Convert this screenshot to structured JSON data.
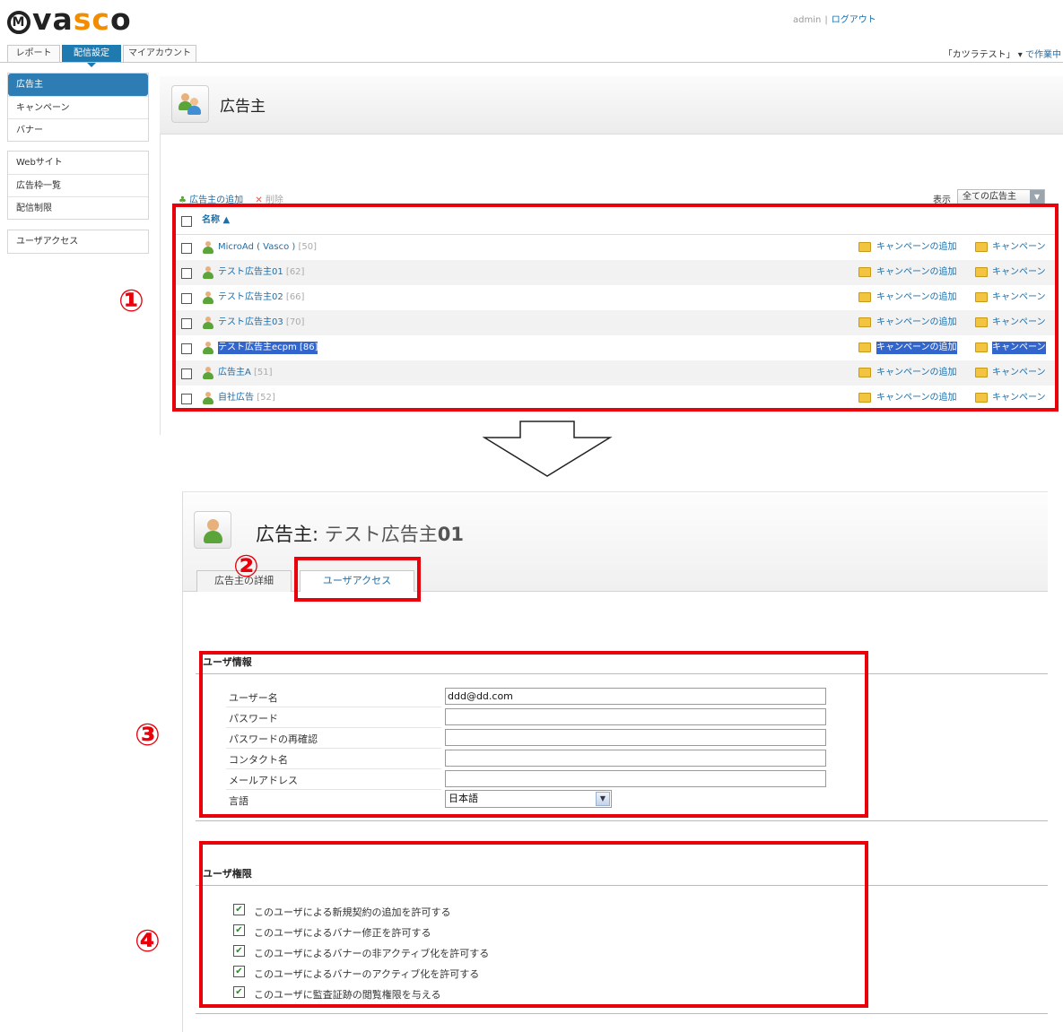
{
  "header": {
    "logo": "vasco",
    "user": "admin",
    "logout": "ログアウト",
    "workspace": "「カツラテスト」",
    "workspace_link": "で作業中"
  },
  "tabs": [
    "レポート",
    "配信設定",
    "マイアカウント"
  ],
  "sidebar": {
    "group1": [
      "広告主",
      "キャンペーン",
      "バナー"
    ],
    "group2": [
      "Webサイト",
      "広告枠一覧",
      "配信制限"
    ],
    "group3": [
      "ユーザアクセス"
    ]
  },
  "top_panel": {
    "title": "広告主",
    "add_label": "広告主の追加",
    "delete_label": "削除",
    "show_label": "表示",
    "show_value": "全ての広告主",
    "name_header": "名称",
    "rows": [
      {
        "name": "MicroAd ( Vasco )",
        "id": "[50]"
      },
      {
        "name": "テスト広告主01",
        "id": "[62]"
      },
      {
        "name": "テスト広告主02",
        "id": "[66]"
      },
      {
        "name": "テスト広告主03",
        "id": "[70]"
      },
      {
        "name": "テスト広告主ecpm",
        "id": "[86]"
      },
      {
        "name": "広告主A",
        "id": "[51]"
      },
      {
        "name": "自社広告",
        "id": "[52]"
      }
    ],
    "col_add_campaign": "キャンペーンの追加",
    "col_campaign": "キャンペーン"
  },
  "annotations": [
    "①",
    "②",
    "③",
    "④"
  ],
  "detail": {
    "title_prefix": "広告主:",
    "title_name": "テスト広告主",
    "title_num": "01",
    "tab_details": "広告主の詳細",
    "tab_user_access": "ユーザアクセス",
    "user_info_title": "ユーザ情報",
    "fields": {
      "username_label": "ユーザー名",
      "username_value": "ddd@dd.com",
      "password_label": "パスワード",
      "password_confirm_label": "パスワードの再確認",
      "contact_label": "コンタクト名",
      "email_label": "メールアドレス",
      "language_label": "言語",
      "language_value": "日本語"
    },
    "permissions_title": "ユーザ権限",
    "permissions": [
      "このユーザによる新規契約の追加を許可する",
      "このユーザによるバナー修正を許可する",
      "このユーザによるバナーの非アクティブ化を許可する",
      "このユーザによるバナーのアクティブ化を許可する",
      "このユーザに監査証跡の閲覧権限を与える"
    ]
  },
  "colors": {
    "accent": "#1f7ab0",
    "annotation": "#e8000b",
    "link": "#1e6ea8"
  }
}
